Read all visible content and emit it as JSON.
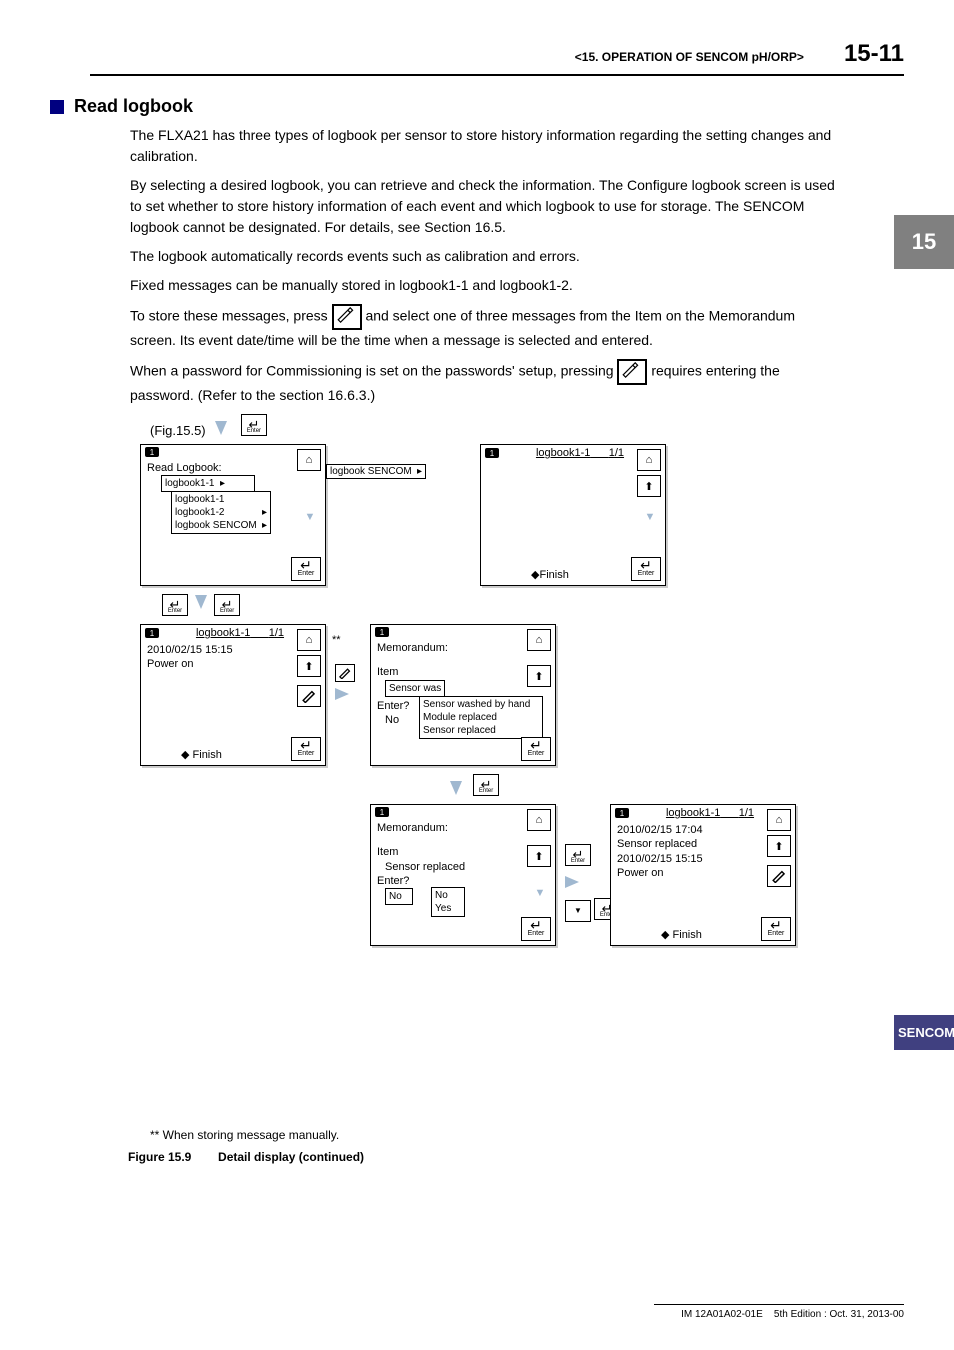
{
  "header": {
    "crumb": "<15.  OPERATION OF SENCOM pH/ORP>",
    "page_number": "15-11"
  },
  "sidebar": {
    "chapter": "15",
    "label": "SENCOM"
  },
  "section": {
    "title": "Read logbook",
    "p1": "The FLXA21 has three types of logbook per sensor to store history information regarding the setting changes and calibration.",
    "p2": "By selecting a desired logbook, you can retrieve and check the information. The Configure logbook screen is used to set whether to store history information of each event and which logbook to use for storage. The SENCOM logbook cannot be designated. For details, see Section 16.5.",
    "p3": "The logbook automatically records events such as calibration and errors.",
    "p4": "Fixed messages can be manually stored in logbook1-1 and logbook1-2.",
    "p5a": "To store these messages, press ",
    "p5b": " and select one of three messages from the Item on the Memorandum screen. Its event date/time will be the time when a message is selected and entered.",
    "p6a": "When a password for Commissioning is set on the passwords' setup, pressing ",
    "p6b": " requires entering the password. (Refer to the section 16.6.3.)"
  },
  "figref": "(Fig.15.5)",
  "screens": {
    "s1": {
      "title": "Read Logbook:",
      "item1": "logbook1-1",
      "opt1": "logbook1-1",
      "opt2": "logbook1-2",
      "opt3": "logbook SENCOM",
      "opt3b": "logbook SENCOM"
    },
    "s2": {
      "title": "logbook1-1",
      "page": "1/1",
      "finish": "Finish"
    },
    "s3": {
      "title": "logbook1-1",
      "page": "1/1",
      "line1": "2010/02/15 15:15",
      "line2": "Power on",
      "finish": "Finish"
    },
    "s4": {
      "title": "Memorandum:",
      "item_label": "Item",
      "item_sel": "Sensor was",
      "opt1": "Sensor washed by hand",
      "opt2": "Module replaced",
      "opt3": "Sensor replaced",
      "enter_label": "Enter?",
      "enter_val": "No"
    },
    "s5": {
      "title": "Memorandum:",
      "item_label": "Item",
      "item_val": "Sensor replaced",
      "enter_label": "Enter?",
      "enter_sel": "No",
      "opt1": "No",
      "opt2": "Yes"
    },
    "s6": {
      "title": "logbook1-1",
      "page": "1/1",
      "line1": "2010/02/15 17:04",
      "line2": "Sensor replaced",
      "line3": "2010/02/15 15:15",
      "line4": "Power on",
      "finish": "Finish"
    },
    "ann": "**"
  },
  "footnote": "** When storing message manually.",
  "figure_caption_num": "Figure 15.9",
  "figure_caption_text": "Detail display (continued)",
  "footer": {
    "doc": "IM 12A01A02-01E",
    "edition": "5th Edition : Oct. 31, 2013-00"
  },
  "enter_label": "Enter"
}
